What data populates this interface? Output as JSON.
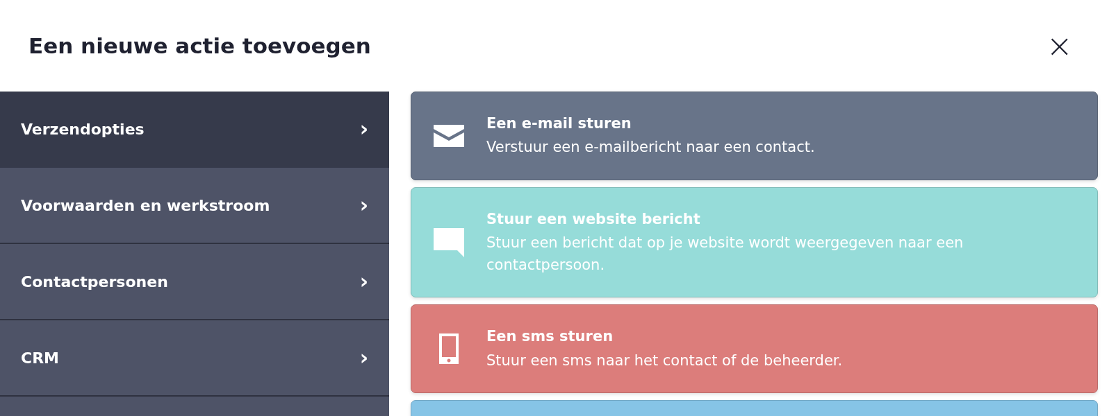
{
  "dialog": {
    "title": "Een nieuwe actie toevoegen",
    "close": "×"
  },
  "sidebar": {
    "items": [
      {
        "label": "Verzendopties",
        "chevron": "›",
        "selected": true
      },
      {
        "label": "Voorwaarden en werkstroom",
        "chevron": "›",
        "selected": false
      },
      {
        "label": "Contactpersonen",
        "chevron": "›",
        "selected": false
      },
      {
        "label": "CRM",
        "chevron": "›",
        "selected": false
      }
    ]
  },
  "actions": [
    {
      "kind": "email",
      "color": "#687489",
      "title": "Een e-mail sturen",
      "description": "Verstuur een e-mailbericht naar een contact."
    },
    {
      "kind": "chat",
      "color": "#96dcd9",
      "title": "Stuur een website bericht",
      "description": "Stuur een bericht dat op je website wordt weergegeven naar een contactpersoon."
    },
    {
      "kind": "phone",
      "color": "#dc7d7b",
      "title": "Een sms sturen",
      "description": "Stuur een sms naar het contact of de beheerder."
    },
    {
      "kind": "partial",
      "color": "#86c4e6"
    }
  ]
}
